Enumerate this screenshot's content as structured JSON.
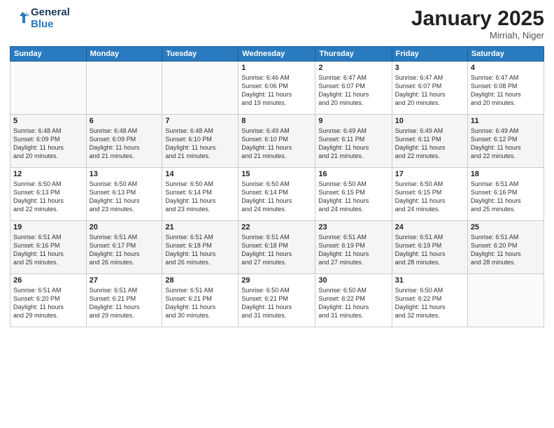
{
  "logo": {
    "line1": "General",
    "line2": "Blue"
  },
  "title": "January 2025",
  "subtitle": "Mirriah, Niger",
  "days_header": [
    "Sunday",
    "Monday",
    "Tuesday",
    "Wednesday",
    "Thursday",
    "Friday",
    "Saturday"
  ],
  "weeks": [
    [
      {
        "day": "",
        "info": ""
      },
      {
        "day": "",
        "info": ""
      },
      {
        "day": "",
        "info": ""
      },
      {
        "day": "1",
        "info": "Sunrise: 6:46 AM\nSunset: 6:06 PM\nDaylight: 11 hours\nand 19 minutes."
      },
      {
        "day": "2",
        "info": "Sunrise: 6:47 AM\nSunset: 6:07 PM\nDaylight: 11 hours\nand 20 minutes."
      },
      {
        "day": "3",
        "info": "Sunrise: 6:47 AM\nSunset: 6:07 PM\nDaylight: 11 hours\nand 20 minutes."
      },
      {
        "day": "4",
        "info": "Sunrise: 6:47 AM\nSunset: 6:08 PM\nDaylight: 11 hours\nand 20 minutes."
      }
    ],
    [
      {
        "day": "5",
        "info": "Sunrise: 6:48 AM\nSunset: 6:09 PM\nDaylight: 11 hours\nand 20 minutes."
      },
      {
        "day": "6",
        "info": "Sunrise: 6:48 AM\nSunset: 6:09 PM\nDaylight: 11 hours\nand 21 minutes."
      },
      {
        "day": "7",
        "info": "Sunrise: 6:48 AM\nSunset: 6:10 PM\nDaylight: 11 hours\nand 21 minutes."
      },
      {
        "day": "8",
        "info": "Sunrise: 6:49 AM\nSunset: 6:10 PM\nDaylight: 11 hours\nand 21 minutes."
      },
      {
        "day": "9",
        "info": "Sunrise: 6:49 AM\nSunset: 6:11 PM\nDaylight: 11 hours\nand 21 minutes."
      },
      {
        "day": "10",
        "info": "Sunrise: 6:49 AM\nSunset: 6:11 PM\nDaylight: 11 hours\nand 22 minutes."
      },
      {
        "day": "11",
        "info": "Sunrise: 6:49 AM\nSunset: 6:12 PM\nDaylight: 11 hours\nand 22 minutes."
      }
    ],
    [
      {
        "day": "12",
        "info": "Sunrise: 6:50 AM\nSunset: 6:13 PM\nDaylight: 11 hours\nand 22 minutes."
      },
      {
        "day": "13",
        "info": "Sunrise: 6:50 AM\nSunset: 6:13 PM\nDaylight: 11 hours\nand 23 minutes."
      },
      {
        "day": "14",
        "info": "Sunrise: 6:50 AM\nSunset: 6:14 PM\nDaylight: 11 hours\nand 23 minutes."
      },
      {
        "day": "15",
        "info": "Sunrise: 6:50 AM\nSunset: 6:14 PM\nDaylight: 11 hours\nand 24 minutes."
      },
      {
        "day": "16",
        "info": "Sunrise: 6:50 AM\nSunset: 6:15 PM\nDaylight: 11 hours\nand 24 minutes."
      },
      {
        "day": "17",
        "info": "Sunrise: 6:50 AM\nSunset: 6:15 PM\nDaylight: 11 hours\nand 24 minutes."
      },
      {
        "day": "18",
        "info": "Sunrise: 6:51 AM\nSunset: 6:16 PM\nDaylight: 11 hours\nand 25 minutes."
      }
    ],
    [
      {
        "day": "19",
        "info": "Sunrise: 6:51 AM\nSunset: 6:16 PM\nDaylight: 11 hours\nand 25 minutes."
      },
      {
        "day": "20",
        "info": "Sunrise: 6:51 AM\nSunset: 6:17 PM\nDaylight: 11 hours\nand 26 minutes."
      },
      {
        "day": "21",
        "info": "Sunrise: 6:51 AM\nSunset: 6:18 PM\nDaylight: 11 hours\nand 26 minutes."
      },
      {
        "day": "22",
        "info": "Sunrise: 6:51 AM\nSunset: 6:18 PM\nDaylight: 11 hours\nand 27 minutes."
      },
      {
        "day": "23",
        "info": "Sunrise: 6:51 AM\nSunset: 6:19 PM\nDaylight: 11 hours\nand 27 minutes."
      },
      {
        "day": "24",
        "info": "Sunrise: 6:51 AM\nSunset: 6:19 PM\nDaylight: 11 hours\nand 28 minutes."
      },
      {
        "day": "25",
        "info": "Sunrise: 6:51 AM\nSunset: 6:20 PM\nDaylight: 11 hours\nand 28 minutes."
      }
    ],
    [
      {
        "day": "26",
        "info": "Sunrise: 6:51 AM\nSunset: 6:20 PM\nDaylight: 11 hours\nand 29 minutes."
      },
      {
        "day": "27",
        "info": "Sunrise: 6:51 AM\nSunset: 6:21 PM\nDaylight: 11 hours\nand 29 minutes."
      },
      {
        "day": "28",
        "info": "Sunrise: 6:51 AM\nSunset: 6:21 PM\nDaylight: 11 hours\nand 30 minutes."
      },
      {
        "day": "29",
        "info": "Sunrise: 6:50 AM\nSunset: 6:21 PM\nDaylight: 11 hours\nand 31 minutes."
      },
      {
        "day": "30",
        "info": "Sunrise: 6:50 AM\nSunset: 6:22 PM\nDaylight: 11 hours\nand 31 minutes."
      },
      {
        "day": "31",
        "info": "Sunrise: 6:50 AM\nSunset: 6:22 PM\nDaylight: 11 hours\nand 32 minutes."
      },
      {
        "day": "",
        "info": ""
      }
    ]
  ]
}
